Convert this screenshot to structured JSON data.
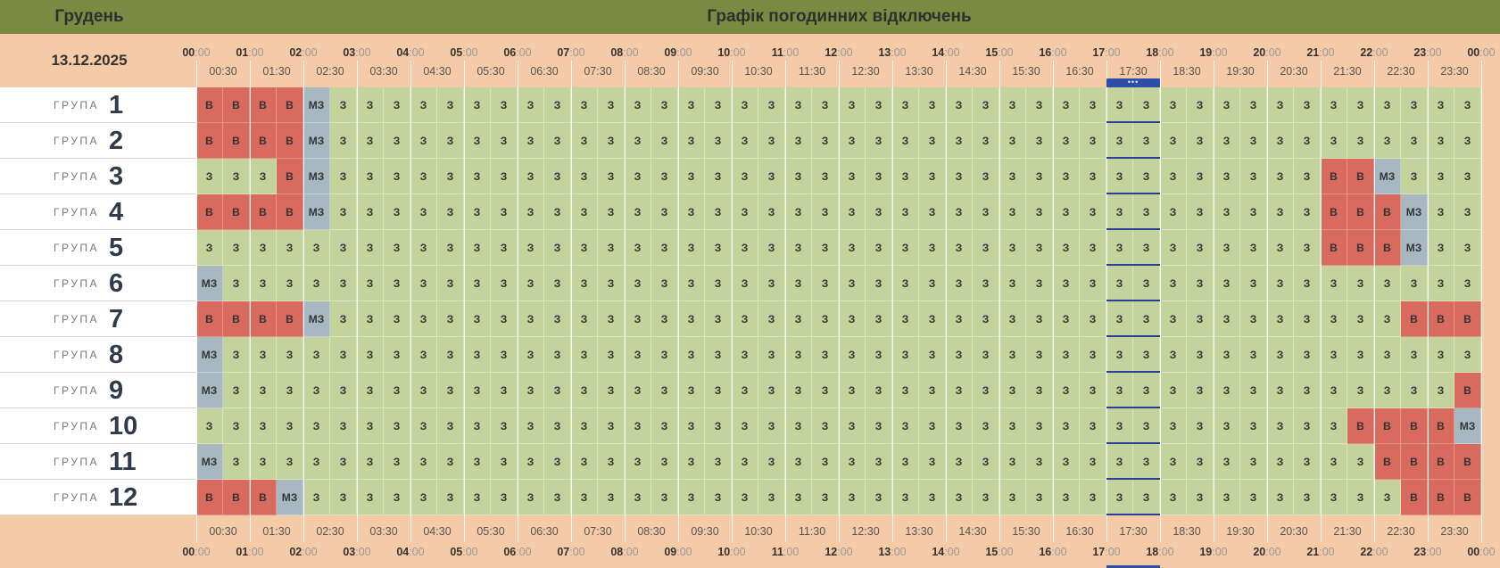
{
  "header": {
    "month": "Грудень",
    "title": "Графік погодинних відключень",
    "date": "13.12.2025"
  },
  "hours": [
    "00",
    "01",
    "02",
    "03",
    "04",
    "05",
    "06",
    "07",
    "08",
    "09",
    "10",
    "11",
    "12",
    "13",
    "14",
    "15",
    "16",
    "17",
    "18",
    "19",
    "20",
    "21",
    "22",
    "23",
    "00"
  ],
  "hour_suffix": ":00",
  "half_hours": [
    "00:30",
    "01:30",
    "02:30",
    "03:30",
    "04:30",
    "05:30",
    "06:30",
    "07:30",
    "08:30",
    "09:30",
    "10:30",
    "11:30",
    "12:30",
    "13:30",
    "14:30",
    "15:30",
    "16:30",
    "17:30",
    "18:30",
    "19:30",
    "20:30",
    "21:30",
    "22:30",
    "23:30"
  ],
  "group_prefix": "ГРУПА",
  "current_slot_indicator": "•••",
  "current_slot_index": 35,
  "status_labels": {
    "on": "З",
    "off": "В",
    "maybe": "МЗ"
  },
  "colors": {
    "on": "#c4d39c",
    "off": "#d96a5e",
    "maybe": "#a8b8c2",
    "header": "#7a8a40",
    "peach": "#f5cba7",
    "now": "#2b4fa8"
  },
  "groups": [
    {
      "number": "1",
      "slots": "BBBBMZZZZZZZZZZZZZZZZZZZZZZZZZZZZZZZZZZZZZZZZZZZ"
    },
    {
      "number": "2",
      "slots": "BBBBMZZZZZZZZZZZZZZZZZZZZZZZZZZZZZZZZZZZZZZZZZZZ"
    },
    {
      "number": "3",
      "slots": "ZZZBMZZZZZZZZZZZZZZZZZZZZZZZZZZZZZZZZZZZZZBBMZZZ"
    },
    {
      "number": "4",
      "slots": "BBBBMZZZZZZZZZZZZZZZZZZZZZZZZZZZZZZZZZZZZZBBBMZZ"
    },
    {
      "number": "5",
      "slots": "ZZZZZZZZZZZZZZZZZZZZZZZZZZZZZZZZZZZZZZZZZZBBBMZZ"
    },
    {
      "number": "6",
      "slots": "MZZZZZZZZZZZZZZZZZZZZZZZZZZZZZZZZZZZZZZZZZZZZZZZ"
    },
    {
      "number": "7",
      "slots": "BBBBMZZZZZZZZZZZZZZZZZZZZZZZZZZZZZZZZZZZZZZZZBBB"
    },
    {
      "number": "8",
      "slots": "MZZZZZZZZZZZZZZZZZZZZZZZZZZZZZZZZZZZZZZZZZZZZZZZ"
    },
    {
      "number": "9",
      "slots": "MZZZZZZZZZZZZZZZZZZZZZZZZZZZZZZZZZZZZZZZZZZZZZZB"
    },
    {
      "number": "10",
      "slots": "ZZZZZZZZZZZZZZZZZZZZZZZZZZZZZZZZZZZZZZZZZZZBBBBM"
    },
    {
      "number": "11",
      "slots": "MZZZZZZZZZZZZZZZZZZZZZZZZZZZZZZZZZZZZZZZZZZZBBBB"
    },
    {
      "number": "12",
      "slots": "BBBMZZZZZZZZZZZZZZZZZZZZZZZZZZZZZZZZZZZZZZZZZBBB"
    }
  ]
}
